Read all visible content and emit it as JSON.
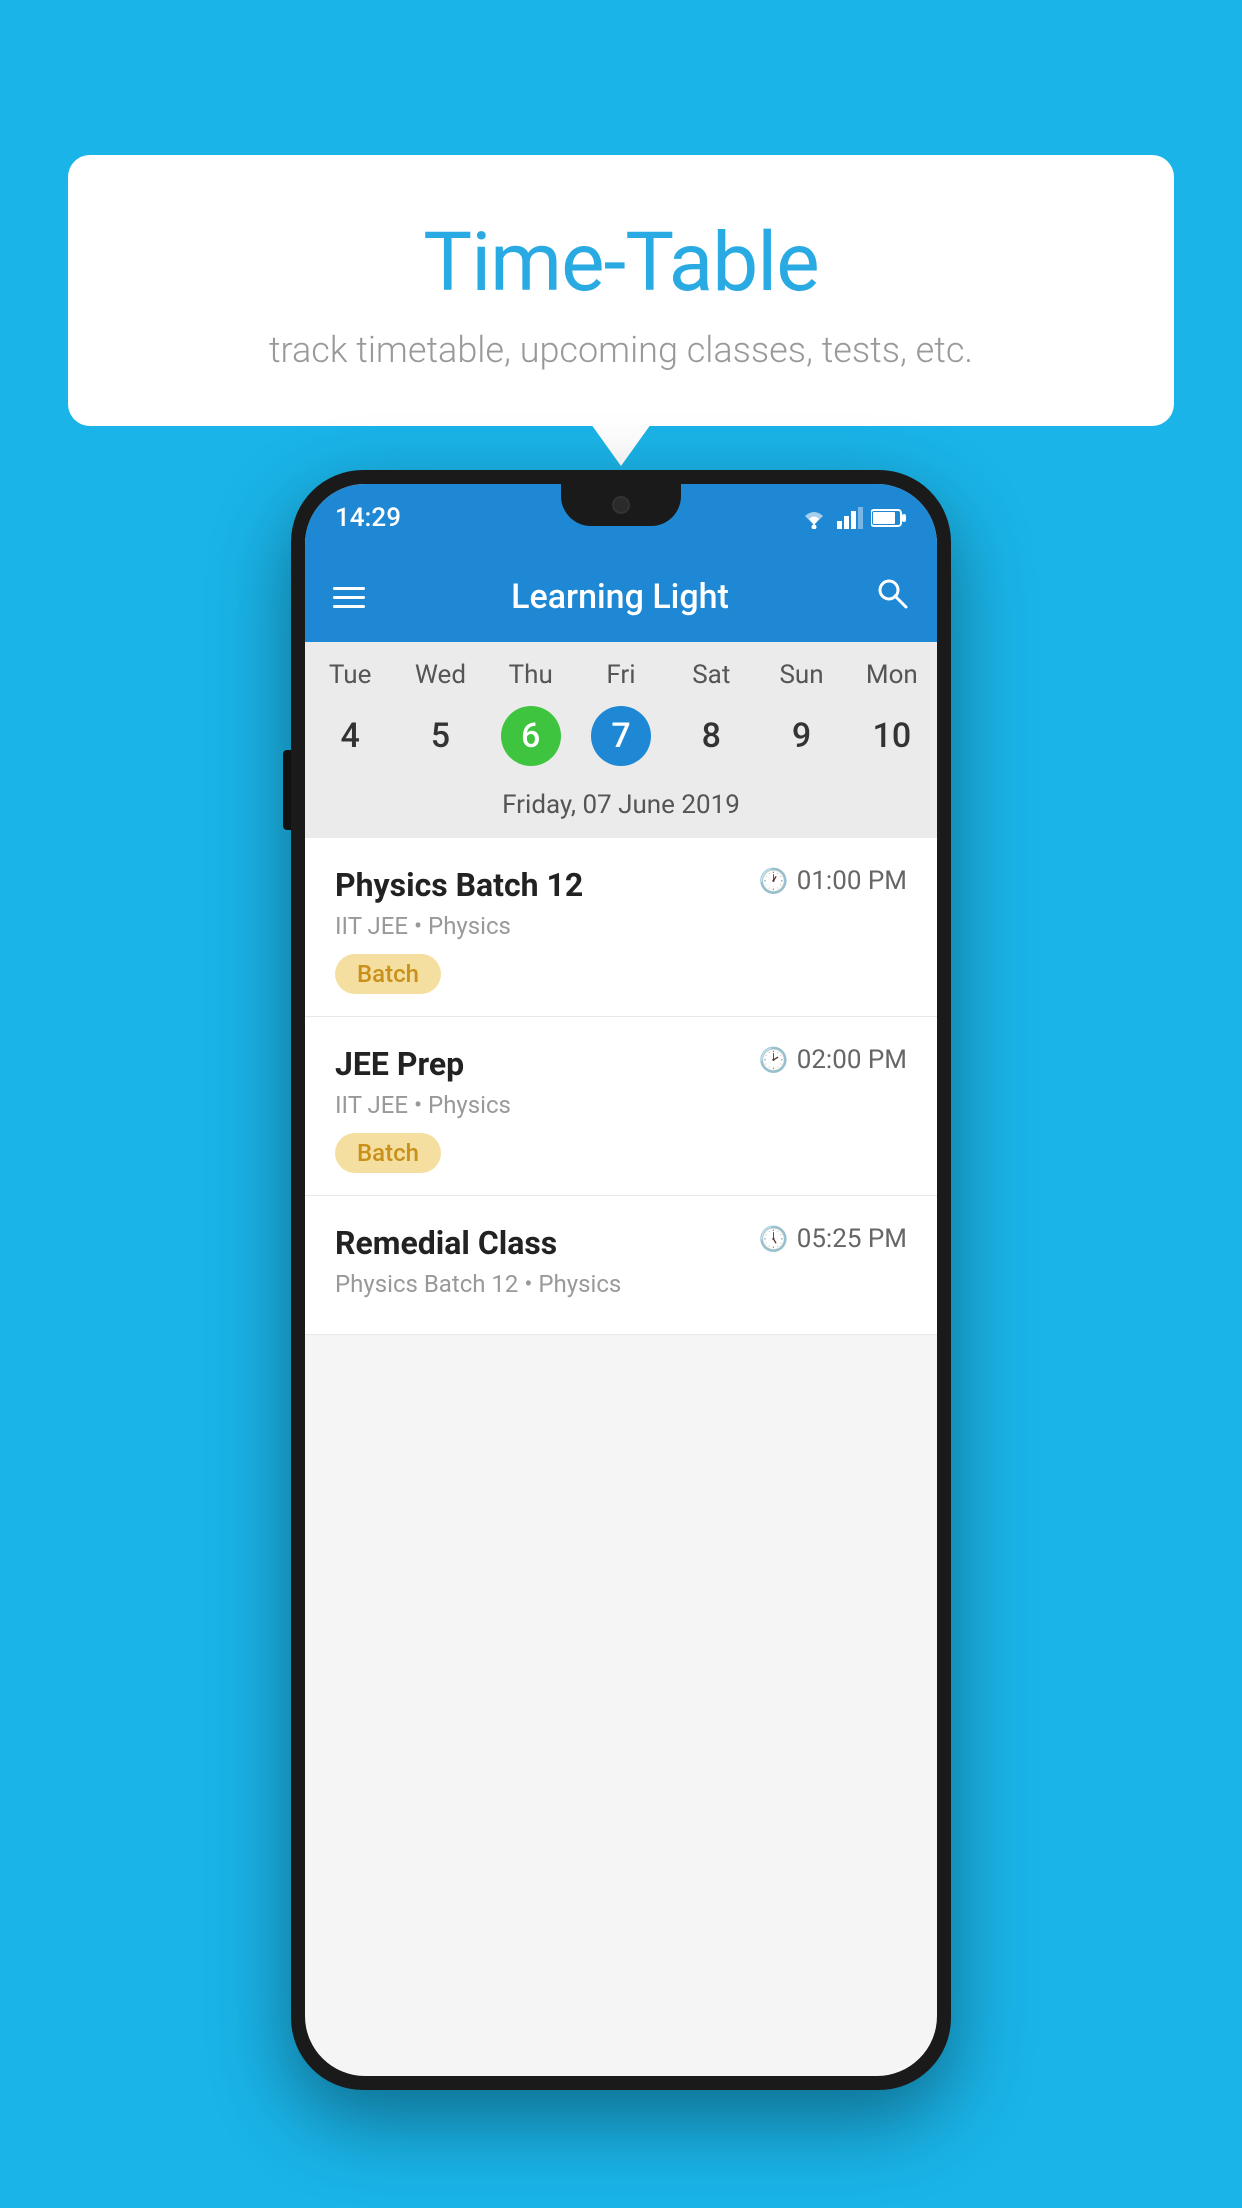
{
  "background_color": "#1ab4e8",
  "bubble": {
    "title": "Time-Table",
    "subtitle": "track timetable, upcoming classes, tests, etc."
  },
  "phone": {
    "status_bar": {
      "time": "14:29"
    },
    "app_bar": {
      "title": "Learning Light",
      "menu_icon": "hamburger-icon",
      "search_icon": "search-icon"
    },
    "calendar": {
      "days": [
        {
          "name": "Tue",
          "num": "4",
          "state": "normal"
        },
        {
          "name": "Wed",
          "num": "5",
          "state": "normal"
        },
        {
          "name": "Thu",
          "num": "6",
          "state": "today"
        },
        {
          "name": "Fri",
          "num": "7",
          "state": "selected"
        },
        {
          "name": "Sat",
          "num": "8",
          "state": "normal"
        },
        {
          "name": "Sun",
          "num": "9",
          "state": "normal"
        },
        {
          "name": "Mon",
          "num": "10",
          "state": "normal"
        }
      ],
      "selected_date_label": "Friday, 07 June 2019"
    },
    "schedule": [
      {
        "title": "Physics Batch 12",
        "time": "01:00 PM",
        "meta": "IIT JEE • Physics",
        "badge": "Batch"
      },
      {
        "title": "JEE Prep",
        "time": "02:00 PM",
        "meta": "IIT JEE • Physics",
        "badge": "Batch"
      },
      {
        "title": "Remedial Class",
        "time": "05:25 PM",
        "meta": "Physics Batch 12 • Physics",
        "badge": ""
      }
    ]
  }
}
